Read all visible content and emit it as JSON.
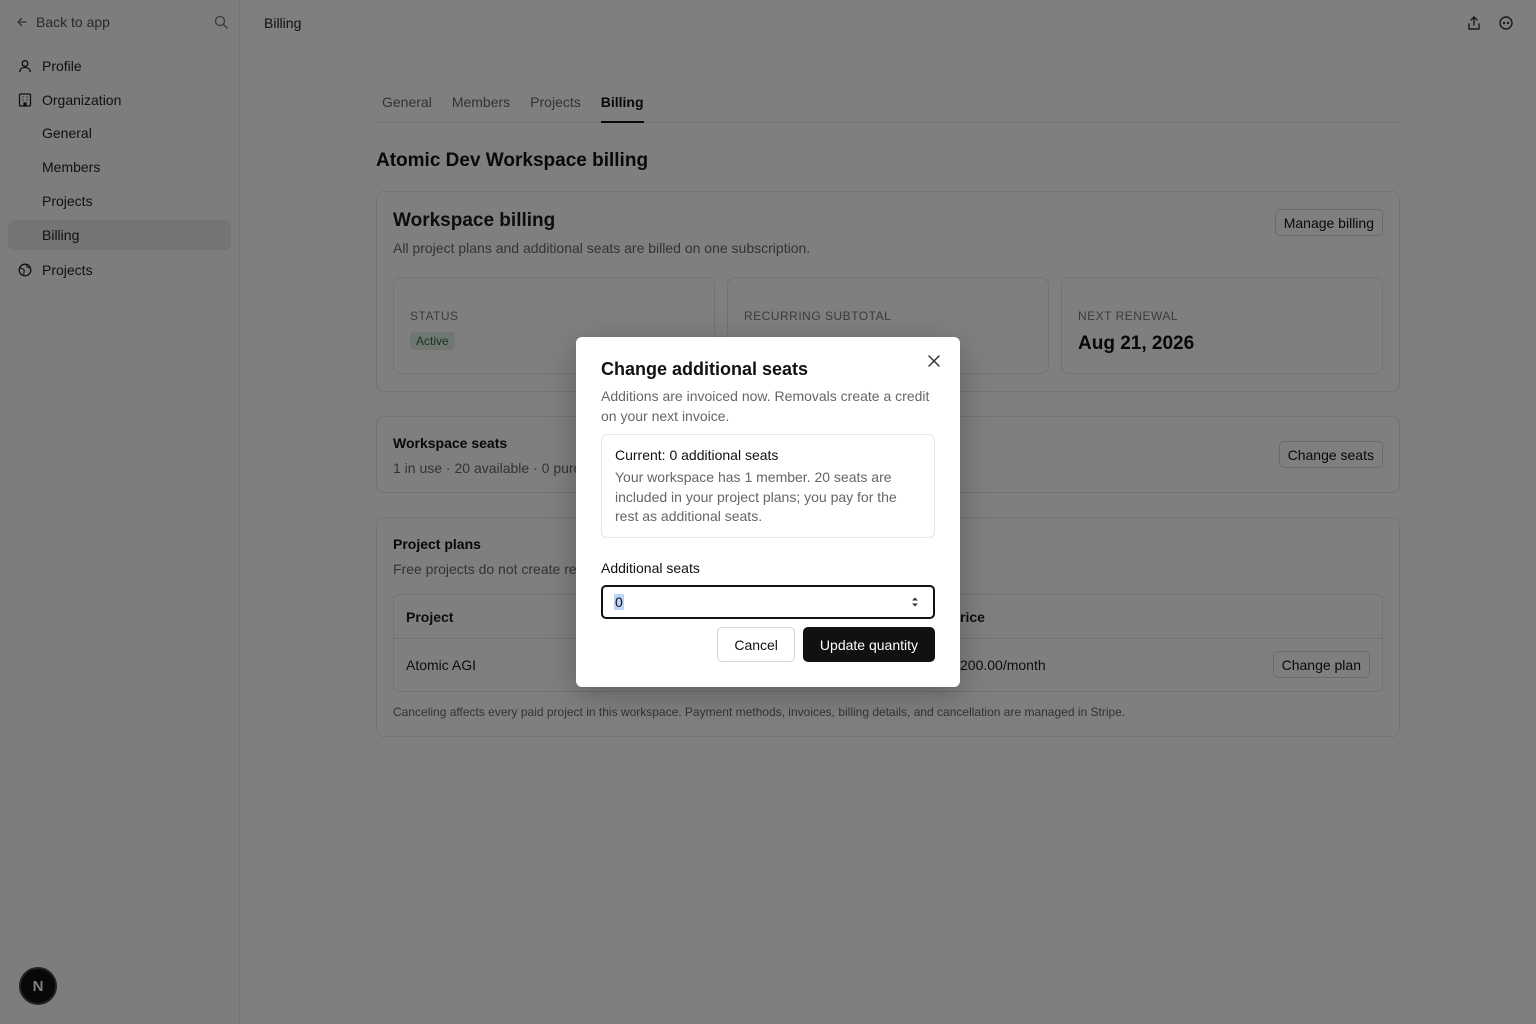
{
  "sidebar": {
    "back_label": "Back to app",
    "back_icon": "arrow-left-icon",
    "search_icon": "search-icon",
    "items": [
      {
        "label": "Profile",
        "icon": "user-icon"
      },
      {
        "label": "Organization",
        "icon": "building-icon"
      },
      {
        "label": "General"
      },
      {
        "label": "Members"
      },
      {
        "label": "Projects"
      },
      {
        "label": "Billing",
        "active": true
      },
      {
        "label": "Projects",
        "icon": "globe-icon"
      }
    ],
    "avatar_letter": "N"
  },
  "topbar": {
    "title": "Billing",
    "icons": [
      "share-icon",
      "settings-icon"
    ]
  },
  "tabs": [
    {
      "label": "General"
    },
    {
      "label": "Members"
    },
    {
      "label": "Projects"
    },
    {
      "label": "Billing",
      "active": true
    }
  ],
  "page_title": "Atomic Dev Workspace billing",
  "workspace_billing": {
    "title": "Workspace billing",
    "subtitle": "All project plans and additional seats are billed on one subscription.",
    "manage_button": "Manage billing",
    "status_label": "STATUS",
    "status_value": "Active",
    "subtotal_label": "RECURRING SUBTOTAL",
    "renewal_label": "NEXT RENEWAL",
    "renewal_value": "Aug 21, 2026"
  },
  "seats": {
    "title": "Workspace seats",
    "subtitle": "1 in use · 20 available · 0 purch",
    "button": "Change seats"
  },
  "plans": {
    "title": "Project plans",
    "subtitle": "Free projects do not create rec",
    "columns": [
      "Project",
      "rice"
    ],
    "rows": [
      {
        "project": "Atomic AGI",
        "price": "200.00/month",
        "button": "Change plan"
      }
    ],
    "footnote": "Canceling affects every paid project in this workspace. Payment methods, invoices, billing details, and cancellation are managed in Stripe."
  },
  "modal": {
    "title": "Change additional seats",
    "description": "Additions are invoiced now. Removals create a credit on your next invoice.",
    "current_title": "Current: 0 additional seats",
    "current_text": "Your workspace has 1 member. 20 seats are included in your project plans; you pay for the rest as additional seats.",
    "field_label": "Additional seats",
    "field_value": "0",
    "cancel": "Cancel",
    "submit": "Update quantity"
  }
}
